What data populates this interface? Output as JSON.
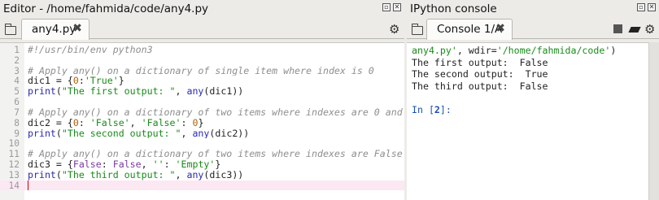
{
  "editor": {
    "title": "Editor - /home/fahmida/code/any4.py",
    "tab": {
      "label": "any4.py",
      "close": "✖"
    },
    "lines": [
      {
        "n": "1",
        "html": "<span class=\"cmt\">#!/usr/bin/env python3</span>"
      },
      {
        "n": "2",
        "html": ""
      },
      {
        "n": "3",
        "html": "<span class=\"cmt\"># Apply any() on a dictionary of single item where index is 0</span>"
      },
      {
        "n": "4",
        "html": "dic1 = {<span class=\"num\">0</span>:<span class=\"str\">'True'</span>}"
      },
      {
        "n": "5",
        "html": "<span class=\"fn\">print</span>(<span class=\"str\">\"The first output: \"</span>, <span class=\"fn\">any</span>(dic1))"
      },
      {
        "n": "6",
        "html": ""
      },
      {
        "n": "7",
        "html": "<span class=\"cmt\"># Apply any() on a dictionary of two items where indexes are 0 and</span>"
      },
      {
        "n": "8",
        "html": "dic2 = {<span class=\"num\">0</span>: <span class=\"str\">'False'</span>, <span class=\"str\">'False'</span>: <span class=\"num\">0</span>}"
      },
      {
        "n": "9",
        "html": "<span class=\"fn\">print</span>(<span class=\"str\">\"The second output: \"</span>, <span class=\"fn\">any</span>(dic2))"
      },
      {
        "n": "10",
        "html": ""
      },
      {
        "n": "11",
        "html": "<span class=\"cmt\"># Apply any() on a dictionary of two items where indexes are False a</span>"
      },
      {
        "n": "12",
        "html": "dic3 = {<span class=\"kw\">False</span>: <span class=\"kw\">False</span>, <span class=\"str\">''</span>: <span class=\"str\">'Empty'</span>}"
      },
      {
        "n": "13",
        "html": "<span class=\"fn\">print</span>(<span class=\"str\">\"The third output: \"</span>, <span class=\"fn\">any</span>(dic3))"
      },
      {
        "n": "14",
        "html": "<span class=\"cursor\"></span>"
      }
    ]
  },
  "console": {
    "title": "IPython console",
    "tab": {
      "label": "Console 1/A",
      "close": "✖"
    },
    "output_lines": [
      {
        "html": "<span class=\"str\">any4.py'</span>, wdir=<span class=\"str\">'/home/fahmida/code'</span>)"
      },
      {
        "html": "The first output:  False"
      },
      {
        "html": "The second output:  True"
      },
      {
        "html": "The third output:  False"
      },
      {
        "html": ""
      },
      {
        "html": "<span class=\"prompt-in\">In [<b>2</b>]:</span>"
      }
    ]
  },
  "pane_buttons": {
    "undock": "▫",
    "close": "✕"
  }
}
